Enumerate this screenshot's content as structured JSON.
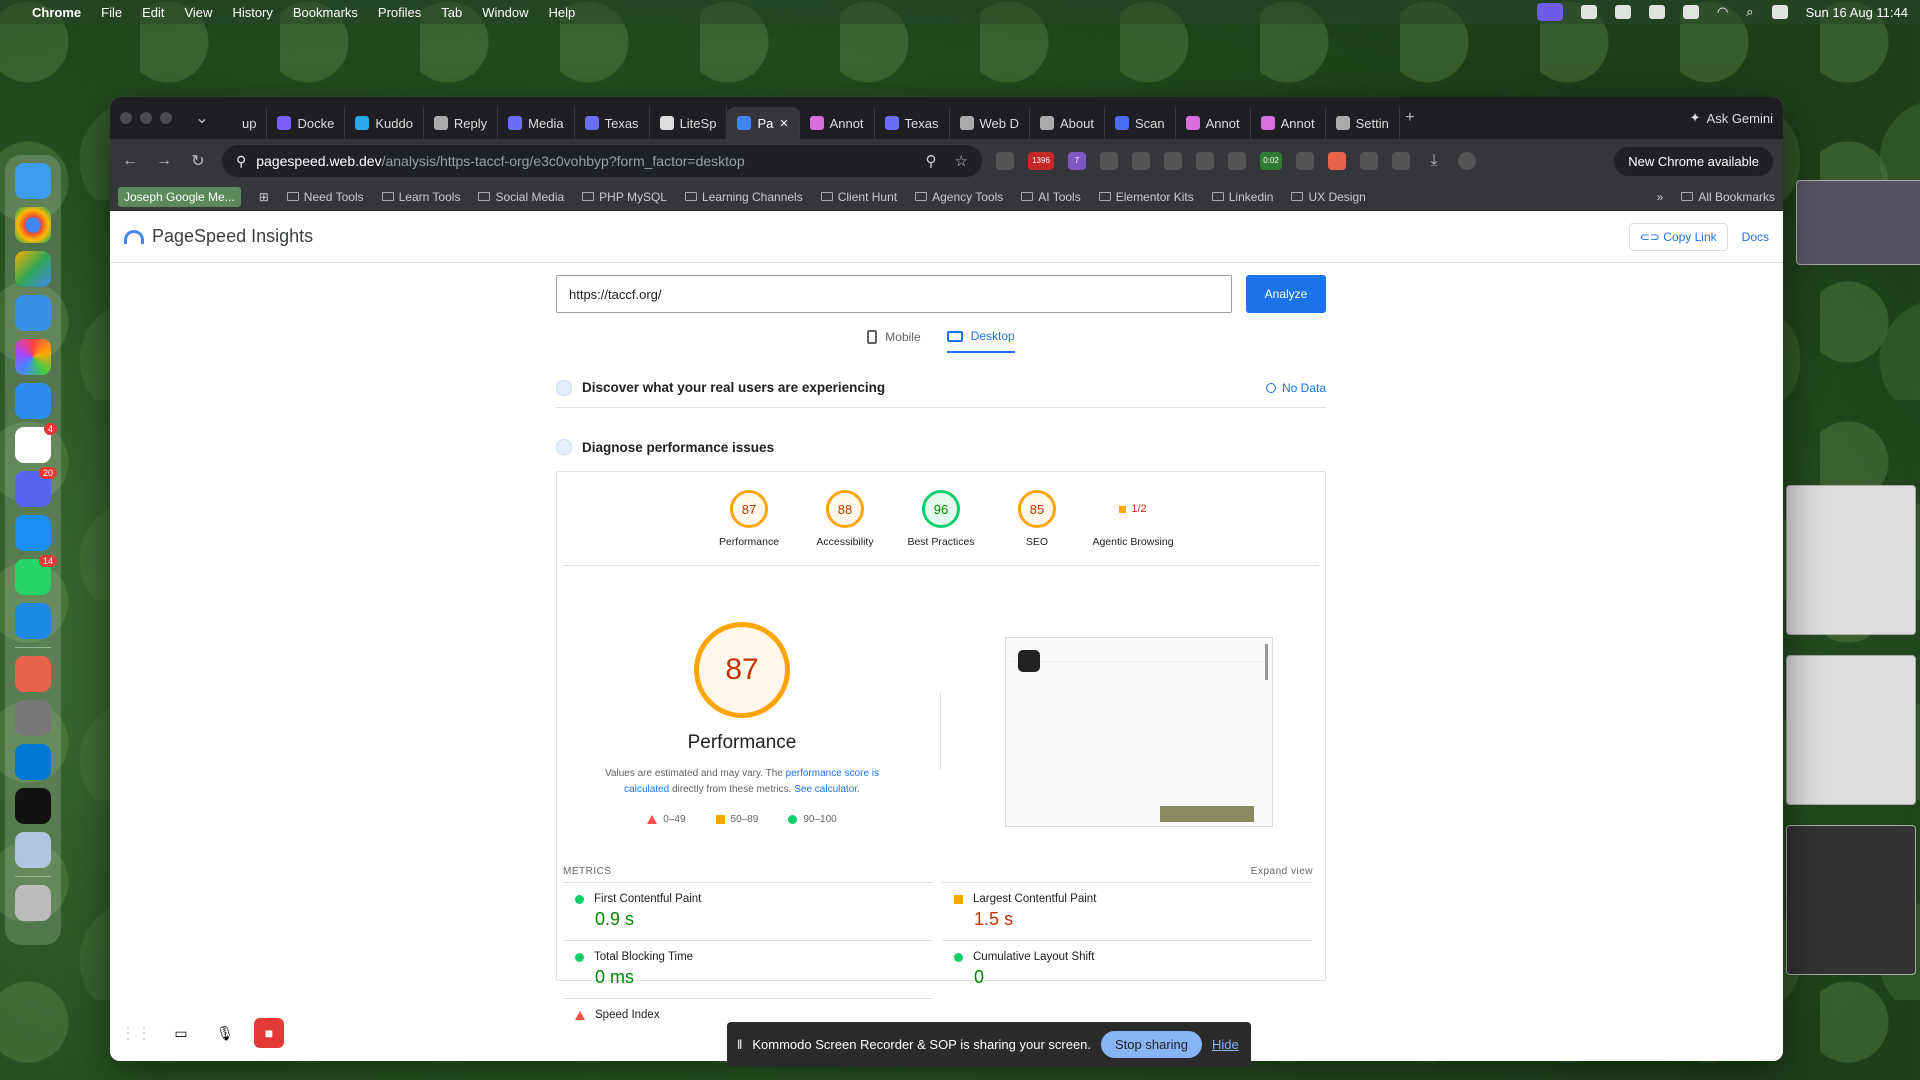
{
  "menubar": {
    "app": "Chrome",
    "menus": [
      "File",
      "Edit",
      "View",
      "History",
      "Bookmarks",
      "Profiles",
      "Tab",
      "Window",
      "Help"
    ],
    "datetime": "Sun 16 Aug  11:44"
  },
  "dock": {
    "badges": [
      "4",
      "20",
      "14"
    ]
  },
  "tabs": [
    {
      "label": "up",
      "color": "#1f1f23"
    },
    {
      "label": "Docke",
      "color": "#7b5cff"
    },
    {
      "label": "Kuddo",
      "color": "#29a8eb"
    },
    {
      "label": "Reply",
      "color": "#aaaaaa"
    },
    {
      "label": "Media",
      "color": "#6c6cff"
    },
    {
      "label": "Texas",
      "color": "#6c6cff"
    },
    {
      "label": "LiteSp",
      "color": "#dddddd"
    },
    {
      "label": "Pa",
      "color": "#4285f4",
      "active": true
    },
    {
      "label": "Annot",
      "color": "#d96ee0"
    },
    {
      "label": "Texas",
      "color": "#6c6cff"
    },
    {
      "label": "Web D",
      "color": "#aaaaaa"
    },
    {
      "label": "About",
      "color": "#aaaaaa"
    },
    {
      "label": "Scan",
      "color": "#4a6cf7"
    },
    {
      "label": "Annot",
      "color": "#d96ee0"
    },
    {
      "label": "Annot",
      "color": "#d96ee0"
    },
    {
      "label": "Settin",
      "color": "#aaaaaa"
    }
  ],
  "gemini": "Ask Gemini",
  "omnibox": {
    "domain": "pagespeed.web.dev",
    "path": "/analysis/https-taccf-org/e3c0vohbyp?form_factor=desktop"
  },
  "new_chrome": "New Chrome available",
  "ext_badges": {
    "count": "1396",
    "seven": "7",
    "timer": "0:02"
  },
  "bookmarks": {
    "first": "Joseph Google Me...",
    "folders": [
      "Need Tools",
      "Learn Tools",
      "Social Media",
      "PHP MySQL",
      "Learning Channels",
      "Client Hunt",
      "Agency Tools",
      "AI Tools",
      "Elementor Kits",
      "Linkedin",
      "UX Design"
    ],
    "all": "All Bookmarks"
  },
  "psi": {
    "title": "PageSpeed Insights",
    "copy_link": "Copy Link",
    "docs": "Docs",
    "url_value": "https://taccf.org/",
    "analyze": "Analyze",
    "mobile": "Mobile",
    "desktop": "Desktop",
    "discover": "Discover what your real users are experiencing",
    "no_data": "No Data",
    "diagnose": "Diagnose performance issues",
    "scores": [
      {
        "value": "87",
        "label": "Performance",
        "status": "orange"
      },
      {
        "value": "88",
        "label": "Accessibility",
        "status": "orange"
      },
      {
        "value": "96",
        "label": "Best Practices",
        "status": "green"
      },
      {
        "value": "85",
        "label": "SEO",
        "status": "orange"
      }
    ],
    "agentic": {
      "value": "1/2",
      "label": "Agentic Browsing"
    },
    "big_score": "87",
    "big_title": "Performance",
    "note_pre": "Values are estimated and may vary. The ",
    "note_link1": "performance score is calculated",
    "note_mid": " directly from these metrics. ",
    "note_link2": "See calculator.",
    "legend": [
      "0–49",
      "50–89",
      "90–100"
    ],
    "metrics_label": "METRICS",
    "expand": "Expand view",
    "metrics": [
      {
        "label": "First Contentful Paint",
        "value": "0.9 s",
        "status": "green"
      },
      {
        "label": "Largest Contentful Paint",
        "value": "1.5 s",
        "status": "orange"
      },
      {
        "label": "Total Blocking Time",
        "value": "0 ms",
        "status": "green"
      },
      {
        "label": "Cumulative Layout Shift",
        "value": "0",
        "status": "green"
      },
      {
        "label": "Speed Index",
        "value": "",
        "status": "red"
      }
    ]
  },
  "share": {
    "text": "Kommodo Screen Recorder & SOP is sharing your screen.",
    "stop": "Stop sharing",
    "hide": "Hide"
  }
}
